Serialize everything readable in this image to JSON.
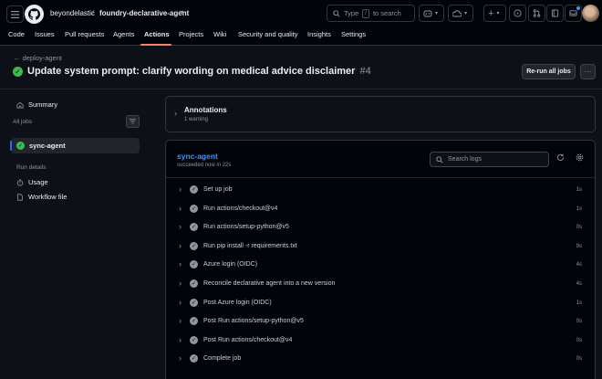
{
  "header": {
    "owner": "beyondelastic",
    "separator": "/",
    "repo": "foundry-declarative-agent",
    "search_text": "Type",
    "search_key": "/",
    "search_suffix": "to search"
  },
  "tabs": [
    "Code",
    "Issues",
    "Pull requests",
    "Agents",
    "Actions",
    "Projects",
    "Wiki",
    "Security and quality",
    "Insights",
    "Settings"
  ],
  "active_tab": "Actions",
  "run": {
    "back_label": "deploy-agent",
    "title": "Update system prompt: clarify wording on medical advice disclaimer",
    "number": "#4",
    "rerun_label": "Re-run all jobs",
    "more_label": "···"
  },
  "sidebar": {
    "summary_label": "Summary",
    "all_jobs_label": "All jobs",
    "job_label": "sync-agent",
    "run_details_label": "Run details",
    "usage_label": "Usage",
    "workflow_file_label": "Workflow file"
  },
  "annotations": {
    "title": "Annotations",
    "subtitle": "1 warning"
  },
  "job": {
    "title": "sync-agent",
    "subtitle": "succeeded now in 22s",
    "search_placeholder": "Search logs",
    "steps": [
      {
        "name": "Set up job",
        "duration": "1s"
      },
      {
        "name": "Run actions/checkout@v4",
        "duration": "1s"
      },
      {
        "name": "Run actions/setup-python@v5",
        "duration": "0s"
      },
      {
        "name": "Run pip install -r requirements.txt",
        "duration": "9s"
      },
      {
        "name": "Azure login (OIDC)",
        "duration": "4s"
      },
      {
        "name": "Reconcile declarative agent into a new version",
        "duration": "4s"
      },
      {
        "name": "Post Azure login (OIDC)",
        "duration": "1s"
      },
      {
        "name": "Post Run actions/setup-python@v5",
        "duration": "0s"
      },
      {
        "name": "Post Run actions/checkout@v4",
        "duration": "0s"
      },
      {
        "name": "Complete job",
        "duration": "0s"
      }
    ]
  },
  "colors": {
    "accent": "#f78166",
    "success": "#3fb950",
    "link": "#4493f8",
    "background": "#0d1117"
  }
}
